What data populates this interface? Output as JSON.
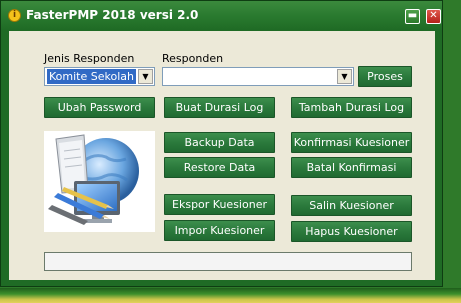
{
  "window": {
    "title": "FasterPMP 2018 versi 2.0",
    "minimize_glyph": "▬",
    "close_glyph": "✕"
  },
  "form": {
    "jenis_label": "Jenis Responden",
    "jenis_value": "Komite Sekolah",
    "responden_label": "Responden",
    "responden_value": ""
  },
  "buttons": {
    "proses": "Proses",
    "ubah_password": "Ubah Password",
    "buat_durasi_log": "Buat Durasi Log",
    "tambah_durasi_log": "Tambah Durasi Log",
    "backup_data": "Backup Data",
    "restore_data": "Restore Data",
    "konfirmasi_kuesioner": "Konfirmasi Kuesioner",
    "batal_konfirmasi": "Batal Konfirmasi",
    "ekspor_kuesioner": "Ekspor Kuesioner",
    "impor_kuesioner": "Impor Kuesioner",
    "salin_kuesioner": "Salin Kuesioner",
    "hapus_kuesioner": "Hapus Kuesioner"
  },
  "progress": {
    "value": 0
  },
  "colors": {
    "accent": "#2b7a3c",
    "titlebar": "#1f6b25",
    "selection": "#316ac5"
  }
}
